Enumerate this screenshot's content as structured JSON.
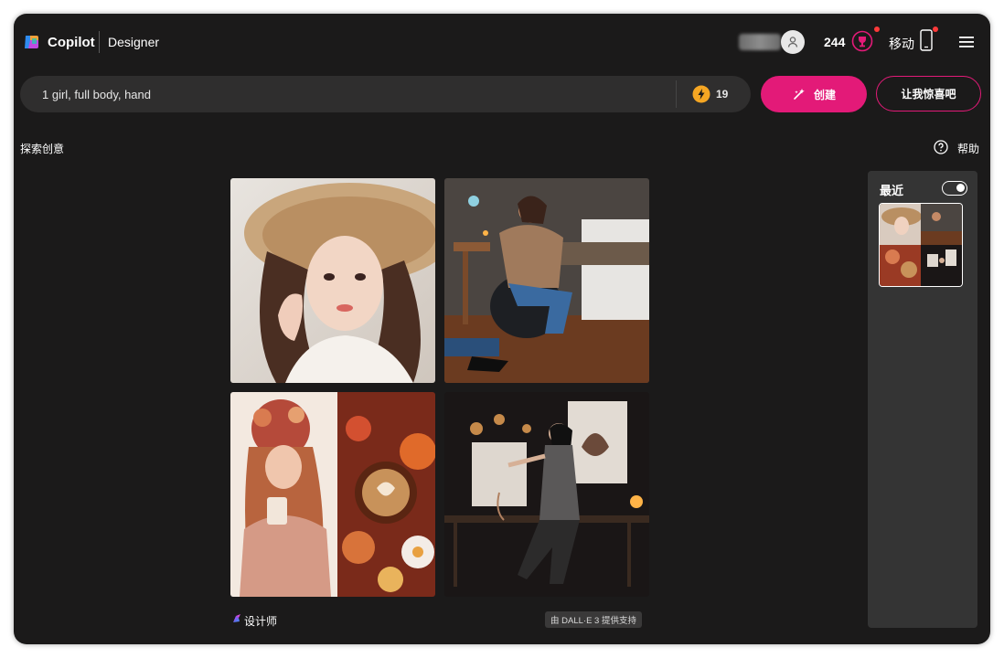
{
  "header": {
    "brand": "Copilot",
    "app_name": "Designer",
    "points": "244",
    "mobile_label": "移动"
  },
  "prompt": {
    "text": "1 girl, full body, hand",
    "boost_count": "19"
  },
  "actions": {
    "create_label": "创建",
    "surprise_label": "让我惊喜吧"
  },
  "section": {
    "explore_label": "探索创意",
    "help_label": "帮助"
  },
  "gallery": {
    "images": [
      {
        "icon": "woman-in-straw-hat-image"
      },
      {
        "icon": "woman-in-bedroom-chair-image"
      },
      {
        "icon": "autumn-coffee-collage-image"
      },
      {
        "icon": "woman-in-dark-studio-image"
      }
    ],
    "designer_label": "设计师",
    "powered_by": "由 DALL·E 3 提供支持"
  },
  "recent": {
    "title": "最近"
  },
  "colors": {
    "accent": "#e31a78",
    "background": "#1b1a1a",
    "panel": "#343434",
    "notification": "#ff3a3a"
  }
}
